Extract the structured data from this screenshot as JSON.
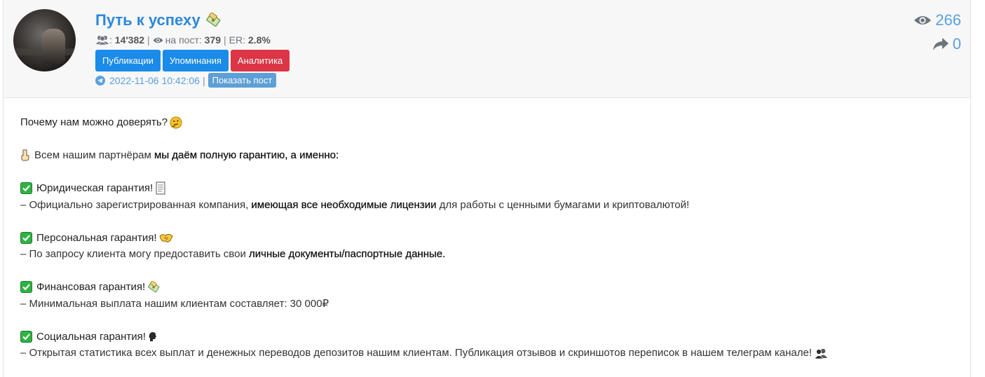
{
  "channel": {
    "title": "Путь к успеху",
    "title_emoji": "money-scroll-emoji"
  },
  "stats": {
    "subscribers": "14'382",
    "per_post_label": "на пост:",
    "per_post": "379",
    "er_label": "ER:",
    "er": "2.8%",
    "separator": "|"
  },
  "buttons": {
    "publications": "Публикации",
    "mentions": "Упоминания",
    "analytics": "Аналитика"
  },
  "post_meta": {
    "datetime": "2022-11-06 10:42:06",
    "separator": "|",
    "show_post": "Показать пост"
  },
  "counters": {
    "views": "266",
    "shares": "0"
  },
  "colors": {
    "accent": "#2c88d9",
    "button_blue": "#1a8be8",
    "button_red": "#dc3545",
    "header_bg": "#f7f7f7"
  },
  "post": {
    "intro": "Почему нам можно доверять?",
    "line2_a": "Всем нашим партнёрам",
    "line2_b": "мы даём полную гарантию, а именно:",
    "g1_title": "Юридическая гарантия!",
    "g1_a": "– Официально зарегистрированная компания,",
    "g1_b": "имеющая все необходимые лицензии",
    "g1_c": "для работы с ценными бумагами и криптовалютой!",
    "g2_title": "Персональная гарантия!",
    "g2_a": "– По запросу клиента могу предоставить свои",
    "g2_b": "личные документы/паспортные данные.",
    "g3_title": "Финансовая гарантия!",
    "g3_a": "– Минимальная выплата нашим клиентам составляет: 30 000₽",
    "g4_title": "Социальная гарантия!",
    "g4_a": "– Открытая статистика всех выплат и денежных переводов депозитов нашим клиентам. Публикация отзывов и скриншотов переписок в нашем телеграм канале!"
  }
}
